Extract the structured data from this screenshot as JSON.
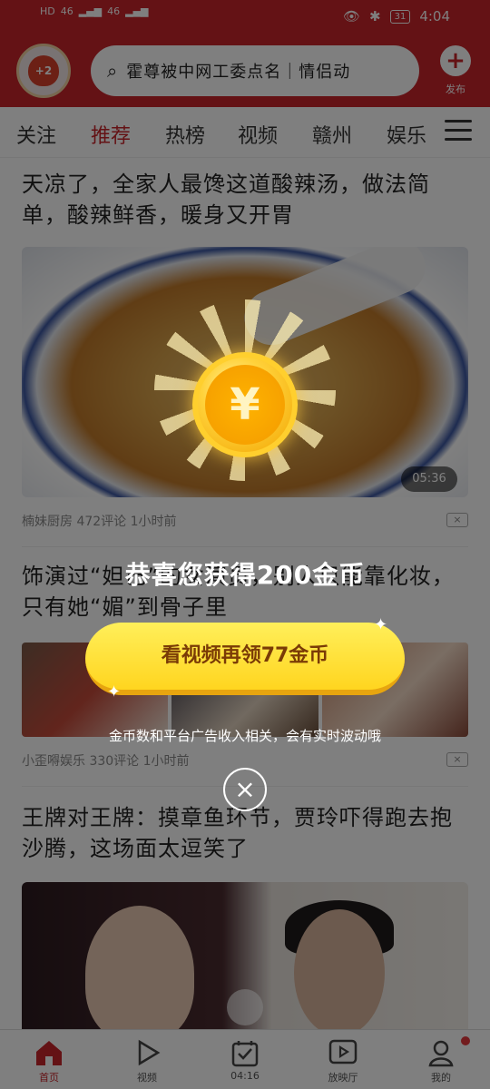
{
  "status_bar": {
    "left_indicators": [
      "HD",
      "46",
      "46"
    ],
    "battery": "31",
    "time": "4:04"
  },
  "header": {
    "avatar_badge": "+2",
    "search_text": "霍尊被中网工委点名｜情侣动",
    "publish_label": "发布"
  },
  "tabs": [
    "关注",
    "推荐",
    "热榜",
    "视频",
    "赣州",
    "娱乐"
  ],
  "active_tab": "推荐",
  "feed": [
    {
      "title": "天凉了，全家人最馋这道酸辣汤，做法简单，酸辣鲜香，暖身又开胃",
      "duration": "05:36",
      "meta": "楠妹厨房  472评论  1小时前"
    },
    {
      "title": "饰演过“妲己”的女演员，别人只能靠化妆，只有她“媚”到骨子里",
      "meta": "小歪嘚娱乐  330评论  1小时前"
    },
    {
      "title": "王牌对王牌：摸章鱼环节，贾玲吓得跑去抱沙腾，这场面太逗笑了"
    }
  ],
  "dismiss_icon": "×",
  "bottom_nav": [
    {
      "label": "首页",
      "icon": "home-icon"
    },
    {
      "label": "视频",
      "icon": "play-icon"
    },
    {
      "label": "04:16",
      "icon": "checkin-icon"
    },
    {
      "label": "放映厅",
      "icon": "theater-icon"
    },
    {
      "label": "我的",
      "icon": "user-icon"
    }
  ],
  "reward_popup": {
    "coin_symbol": "¥",
    "title": "恭喜您获得200金币",
    "button_label": "看视频再领77金币",
    "note": "金币数和平台广告收入相关，会有实时波动哦",
    "close_icon": "×"
  },
  "colors": {
    "brand_red": "#c8242a",
    "coin_gold": "#ffcf2e",
    "button_yellow": "#ffe23a"
  }
}
